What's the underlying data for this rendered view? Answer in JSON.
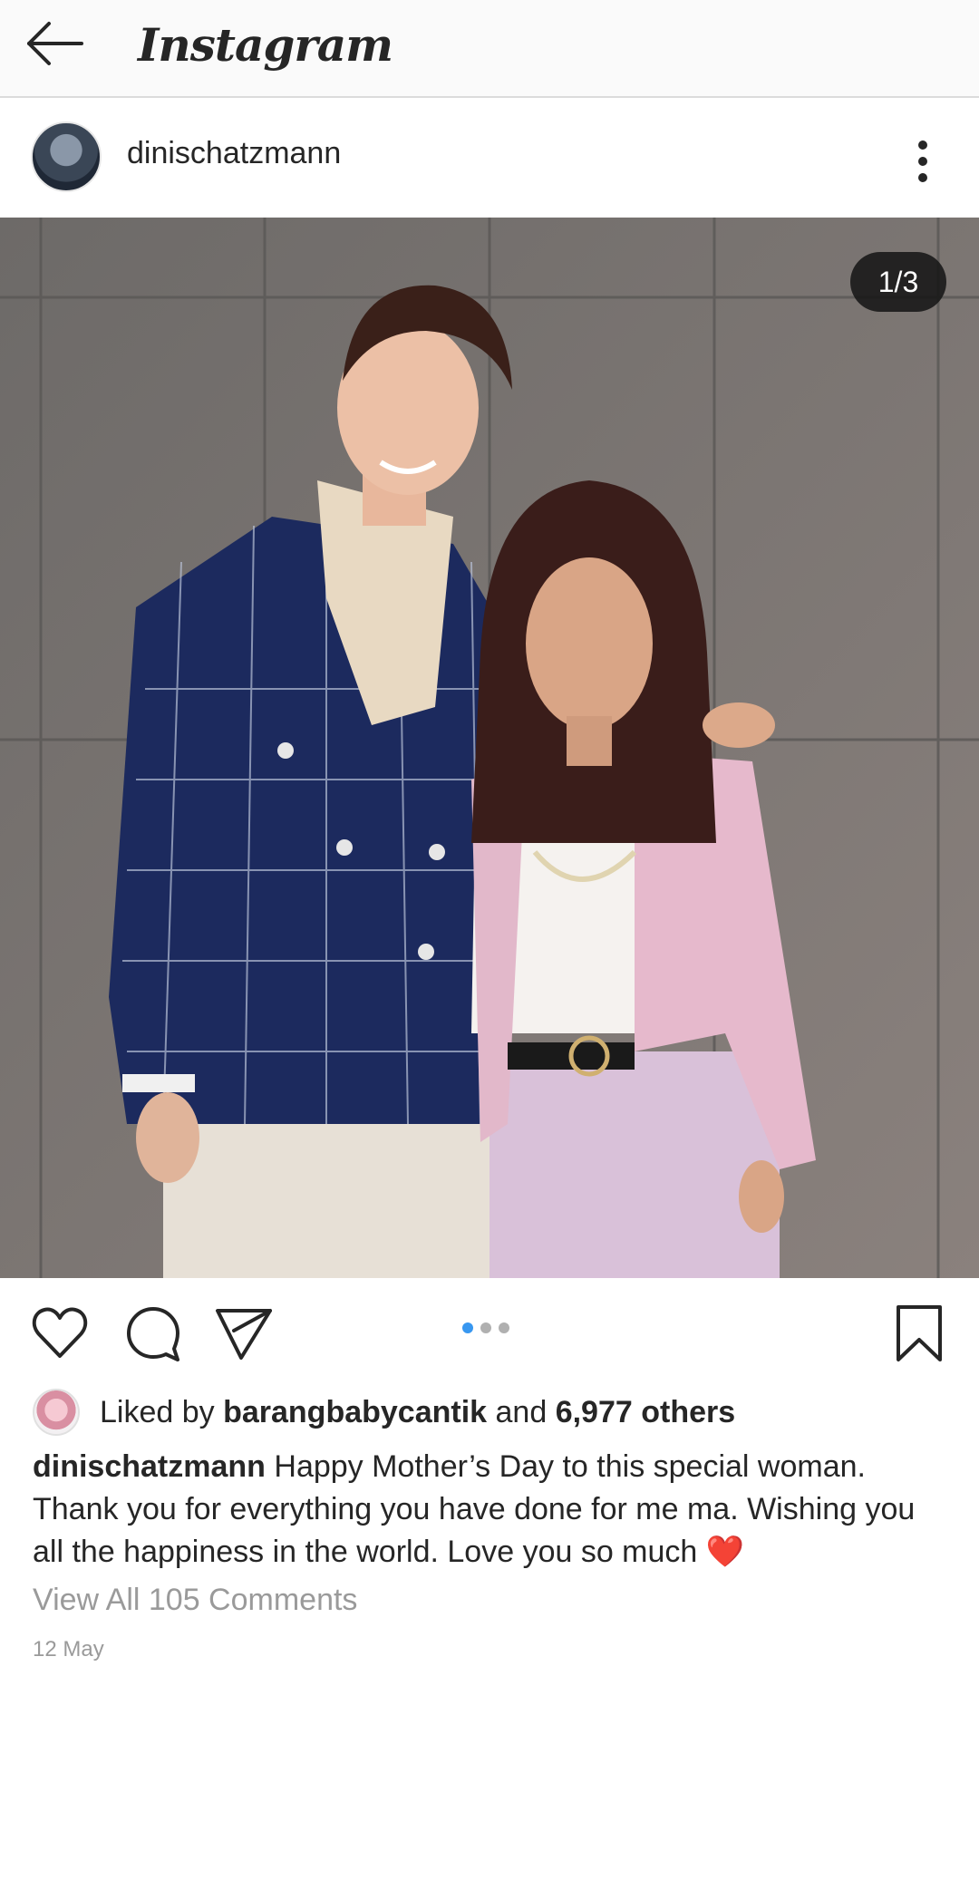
{
  "topbar": {
    "back_icon": "arrow-left-icon",
    "logo_text": "Instagram"
  },
  "post": {
    "username": "dinischatzmann",
    "more_icon": "vertical-dots-icon",
    "image_counter": "1/3",
    "carousel": {
      "total": 3,
      "active_index": 0
    }
  },
  "actions": {
    "like_icon": "heart-outline-icon",
    "comment_icon": "comment-bubble-icon",
    "share_icon": "paper-plane-icon",
    "save_icon": "bookmark-outline-icon"
  },
  "likes": {
    "prefix": "Liked by ",
    "liker": "barangbabycantik",
    "middle": " and ",
    "others": "6,977 others"
  },
  "caption": {
    "username": "dinischatzmann",
    "text": " Happy Mother’s Day to this special woman. Thank you for everything you have done for me ma. Wishing you all the happiness in the world. Love you so much ",
    "emoji": "❤️"
  },
  "comments": {
    "view_all": "View All 105 Comments"
  },
  "date": "12 May",
  "colors": {
    "accent_dot": "#3897f0",
    "heart_emoji": "#e0202e",
    "muted_text": "#9a9a9a"
  }
}
